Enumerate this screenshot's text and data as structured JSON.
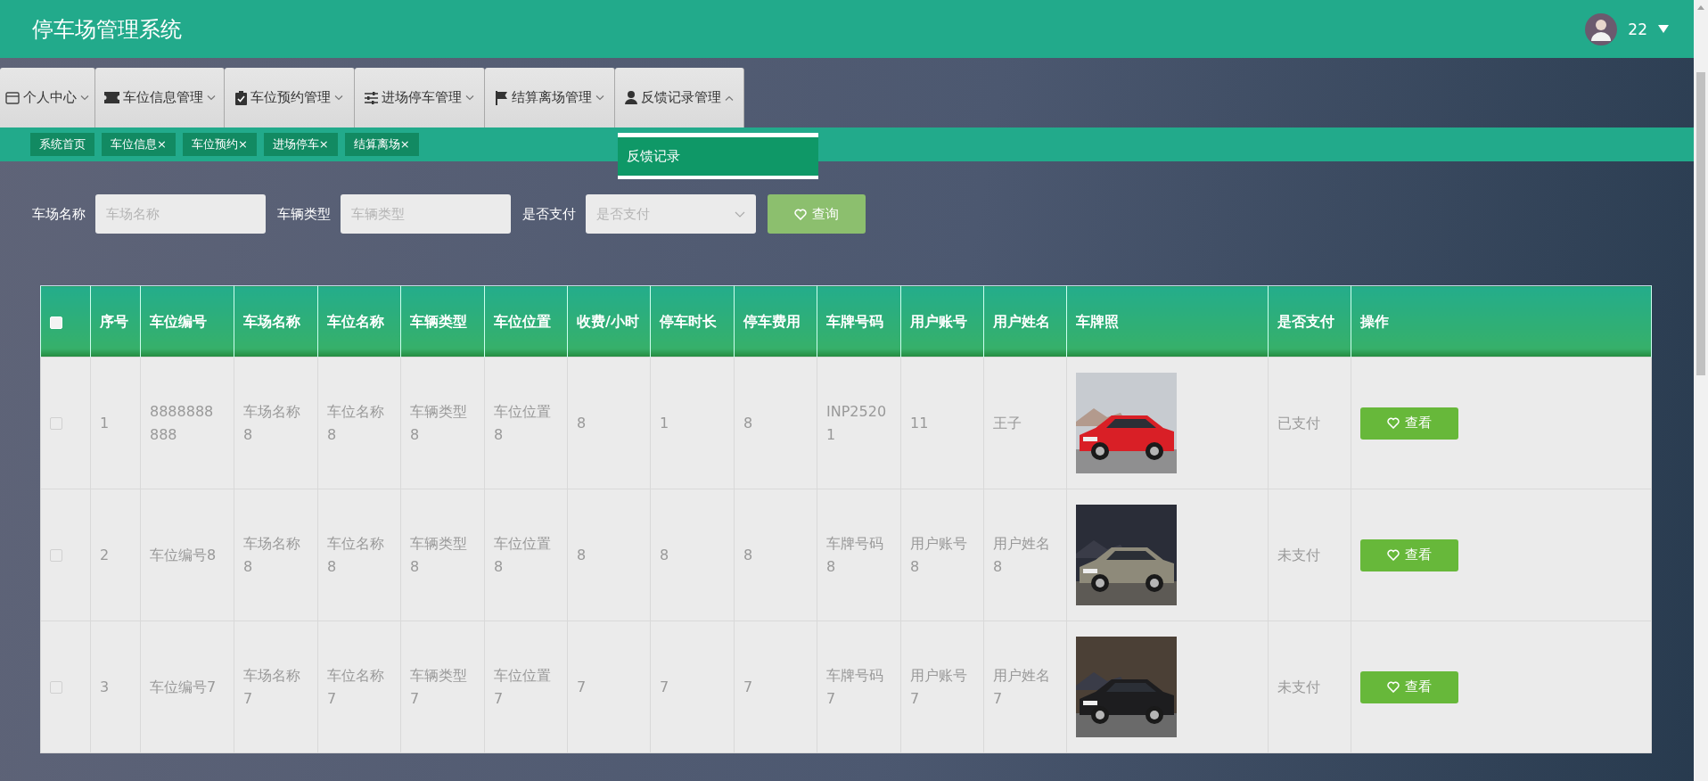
{
  "header": {
    "title": "停车场管理系统",
    "user": {
      "name": "22"
    }
  },
  "menu": [
    {
      "label": "个人中心",
      "expanded": false
    },
    {
      "label": "车位信息管理",
      "expanded": false
    },
    {
      "label": "车位预约管理",
      "expanded": false
    },
    {
      "label": "进场停车管理",
      "expanded": false
    },
    {
      "label": "结算离场管理",
      "expanded": false
    },
    {
      "label": "反馈记录管理",
      "expanded": true,
      "submenu": [
        {
          "label": "反馈记录",
          "selected": true
        }
      ]
    }
  ],
  "tags": [
    {
      "label": "系统首页"
    },
    {
      "label": "车位信息",
      "close": "×"
    },
    {
      "label": "车位预约",
      "close": "×"
    },
    {
      "label": "进场停车",
      "close": "×"
    },
    {
      "label": "结算离场",
      "close": "×"
    }
  ],
  "search": {
    "fields": [
      {
        "kind": "input",
        "label": "车场名称",
        "placeholder": "车场名称"
      },
      {
        "kind": "input",
        "label": "车辆类型",
        "placeholder": "车辆类型"
      },
      {
        "kind": "select",
        "label": "是否支付",
        "placeholder": "是否支付"
      }
    ],
    "button": "查询"
  },
  "table": {
    "select_all": {
      "checked": false
    },
    "columns": [
      "序号",
      "车位编号",
      "车场名称",
      "车位名称",
      "车辆类型",
      "车位位置",
      "收费/小时",
      "停车时长",
      "停车费用",
      "车牌号码",
      "用户账号",
      "用户姓名",
      "车牌照",
      "是否支付",
      "操作"
    ],
    "rows": [
      {
        "checked": false,
        "cells": [
          "1",
          "8888888888",
          "车场名称8",
          "车位名称8",
          "车辆类型8",
          "车位位置8",
          "8",
          "1",
          "8",
          "INP25201",
          "11",
          "王子"
        ],
        "paid": "已支付",
        "action": "查看"
      },
      {
        "checked": false,
        "cells": [
          "2",
          "车位编号8",
          "车场名称8",
          "车位名称8",
          "车辆类型8",
          "车位位置8",
          "8",
          "8",
          "8",
          "车牌号码8",
          "用户账号8",
          "用户姓名8"
        ],
        "paid": "未支付",
        "action": "查看"
      },
      {
        "checked": false,
        "cells": [
          "3",
          "车位编号7",
          "车场名称7",
          "车位名称7",
          "车辆类型7",
          "车位位置7",
          "7",
          "7",
          "7",
          "车牌号码7",
          "用户账号7",
          "用户姓名7"
        ],
        "paid": "未支付",
        "action": "查看"
      }
    ]
  }
}
